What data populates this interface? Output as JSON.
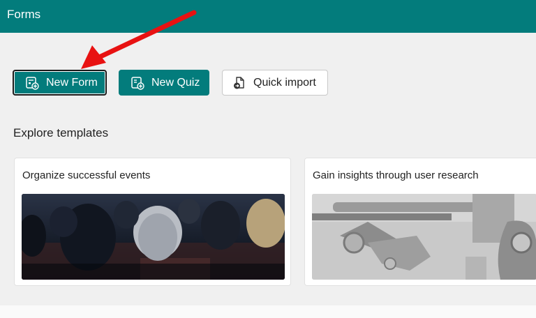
{
  "app": {
    "title": "Forms"
  },
  "actions": {
    "new_form": "New Form",
    "new_quiz": "New Quiz",
    "quick_import": "Quick import"
  },
  "templates": {
    "heading": "Explore templates",
    "cards": [
      {
        "title": "Organize successful events"
      },
      {
        "title": "Gain insights through user research"
      }
    ]
  },
  "colors": {
    "brand": "#037c7c",
    "annotation_arrow": "#e81212"
  },
  "icons": {
    "new_form": "form-add-icon",
    "new_quiz": "quiz-add-icon",
    "quick_import": "document-import-icon"
  }
}
